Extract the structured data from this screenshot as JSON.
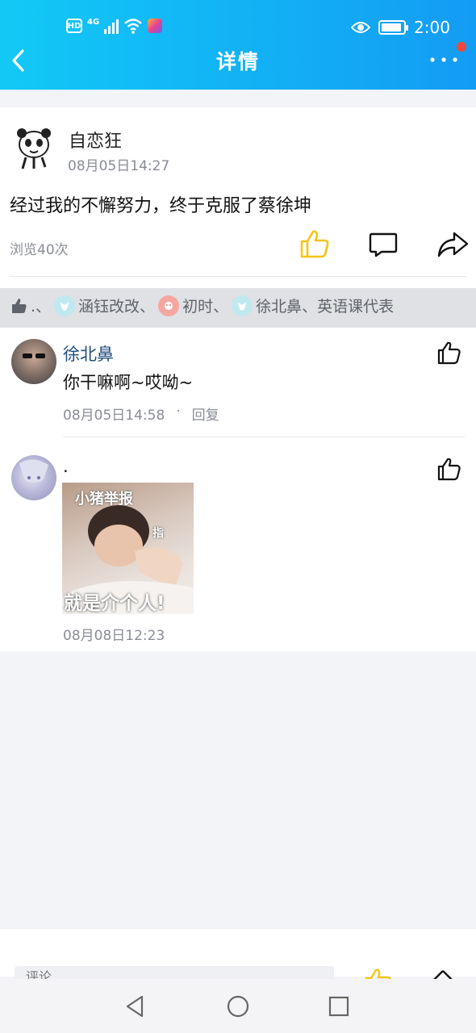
{
  "status_bar": {
    "network": "4G",
    "hd": "HD",
    "time": "2:00"
  },
  "nav": {
    "title": "详情"
  },
  "post": {
    "author": "自恋狂",
    "time": "08月05日14:27",
    "text": "经过我的不懈努力，终于克服了蔡徐坤",
    "views": "浏览40次"
  },
  "likers": {
    "items": [
      ".、",
      "涵钰改改、",
      "初时、",
      "徐北鼻、英语课代表"
    ]
  },
  "comments": [
    {
      "name": "徐北鼻",
      "text": "你干嘛啊~哎呦~",
      "time": "08月05日14:58",
      "reply": "回复"
    },
    {
      "name": ".",
      "sticker_top": "小猪举报",
      "sticker_mid": "指",
      "sticker_bottom": "就是介个人!",
      "time": "08月08日12:23"
    }
  ],
  "bottom": {
    "input_placeholder": "评论"
  },
  "colors": {
    "accent_like": "#f5c518",
    "header_start": "#12c9f6",
    "header_end": "#139cf4",
    "name_link": "#1f4d7d"
  }
}
